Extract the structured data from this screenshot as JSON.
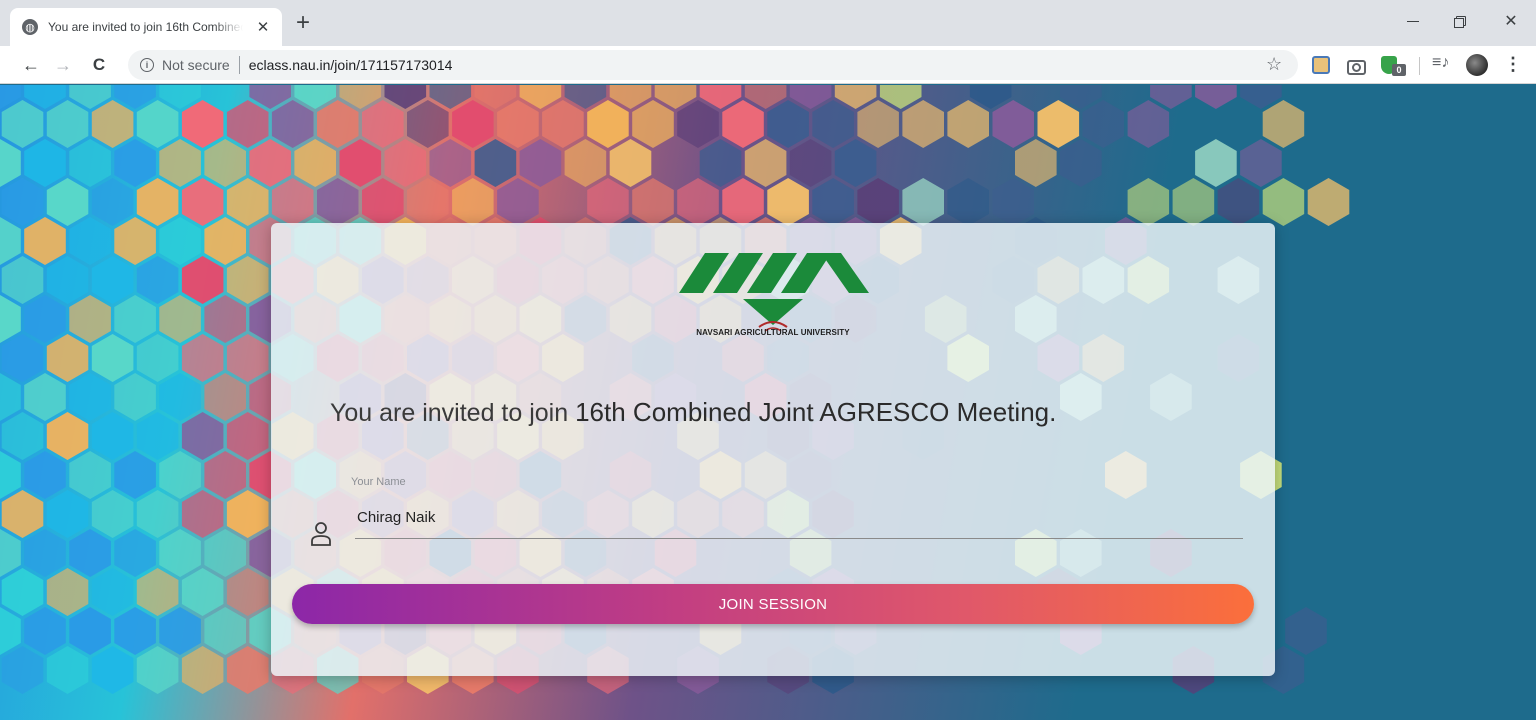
{
  "browser": {
    "tab_title": "You are invited to join 16th Combined Joint AGRESCO Meeting.",
    "tab_close": "✕",
    "new_tab": "+",
    "security_label": "Not secure",
    "url": "eclass.nau.in/join/171157173014",
    "extension_badge": "0",
    "icons": [
      "globe-icon",
      "back-arrow-icon",
      "forward-arrow-icon",
      "reload-icon",
      "info-icon",
      "star-icon",
      "camera-icon",
      "shield-icon",
      "media-queue-icon",
      "menu-icon"
    ]
  },
  "card": {
    "logo_caption": "NAVSARI AGRICULTURAL UNIVERSITY",
    "invite_prefix": "You are invited to join ",
    "meeting_name": "16th Combined Joint AGRESCO Meeting.",
    "name_label": "Your Name",
    "name_value": "Chirag Naik",
    "join_label": "JOIN SESSION"
  },
  "colors": {
    "logo_green": "#1b8a3a",
    "button_start": "#8c27a8",
    "button_end": "#fb6f3b",
    "page_teal": "#1e6b8c"
  }
}
